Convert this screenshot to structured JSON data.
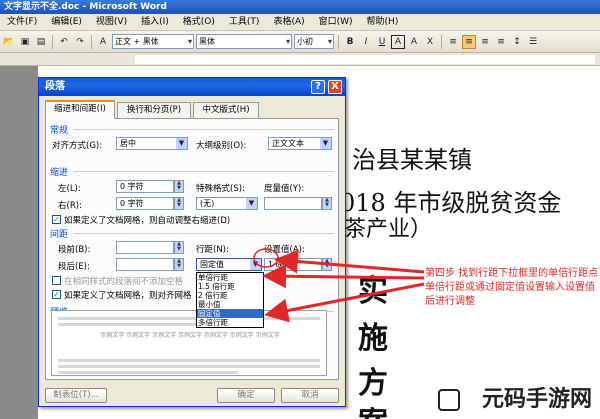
{
  "window": {
    "title": "文字显示不全.doc - Microsoft Word"
  },
  "menubar": [
    "文件(F)",
    "编辑(E)",
    "视图(V)",
    "插入(I)",
    "格式(O)",
    "工具(T)",
    "表格(A)",
    "窗口(W)",
    "帮助(H)"
  ],
  "toolbar": {
    "style": "正文 + 黑体",
    "font": "黑体",
    "size": "小初",
    "bold": "B",
    "italic": "I",
    "underline": "U",
    "font_color": "A"
  },
  "document": {
    "line1": "治县某某镇",
    "line2": "018 年市级脱贫资金",
    "line3": "茶产业）",
    "char1": "实",
    "char2": "施",
    "char3": "方",
    "char4": "案"
  },
  "dialog": {
    "title": "段落",
    "help": "?",
    "close": "X",
    "tabs": [
      "缩进和间距(I)",
      "换行和分页(P)",
      "中文版式(H)"
    ],
    "general": {
      "heading": "常规",
      "alignment_label": "对齐方式(G):",
      "alignment_value": "居中",
      "outline_label": "大纲级别(O):",
      "outline_value": "正文文本"
    },
    "indent": {
      "heading": "缩进",
      "left_label": "左(L):",
      "left_value": "0 字符",
      "right_label": "右(R):",
      "right_value": "0 字符",
      "special_label": "特殊格式(S):",
      "special_value": "(无)",
      "measure_label": "度量值(Y):",
      "measure_value": "",
      "grid_check": "如果定义了文档网格，则自动调整右缩进(D)"
    },
    "spacing": {
      "heading": "间距",
      "before_label": "段前(B):",
      "before_value": "",
      "after_label": "段后(E):",
      "after_value": "",
      "line_label": "行距(N):",
      "line_value": "固定值",
      "setting_label": "设置值(A):",
      "setting_value": "1 磅",
      "same_style_check": "在相同样式的段落间不添加空格",
      "grid_check": "如果定义了文档网格，则对齐网格"
    },
    "preview_heading": "预览",
    "preview_text": "示例文字 示例文字 示例文字 示例文字 示例文字 示例文字 示例文字",
    "buttons": {
      "tabs": "制表位(T)...",
      "ok": "确定",
      "cancel": "取消"
    }
  },
  "line_spacing_options": [
    "单倍行距",
    "1.5 倍行距",
    "2 倍行距",
    "最小值",
    "固定值",
    "多倍行距"
  ],
  "selected_option_index": 4,
  "annotation": "第四步 找到行距下拉框里的单倍行距点单倍行距或通过固定值设置输入设置值后进行调整",
  "watermark": "元码手游网",
  "colors": {
    "annotation": "#e0282a",
    "title_bar": "#0a5fde"
  }
}
